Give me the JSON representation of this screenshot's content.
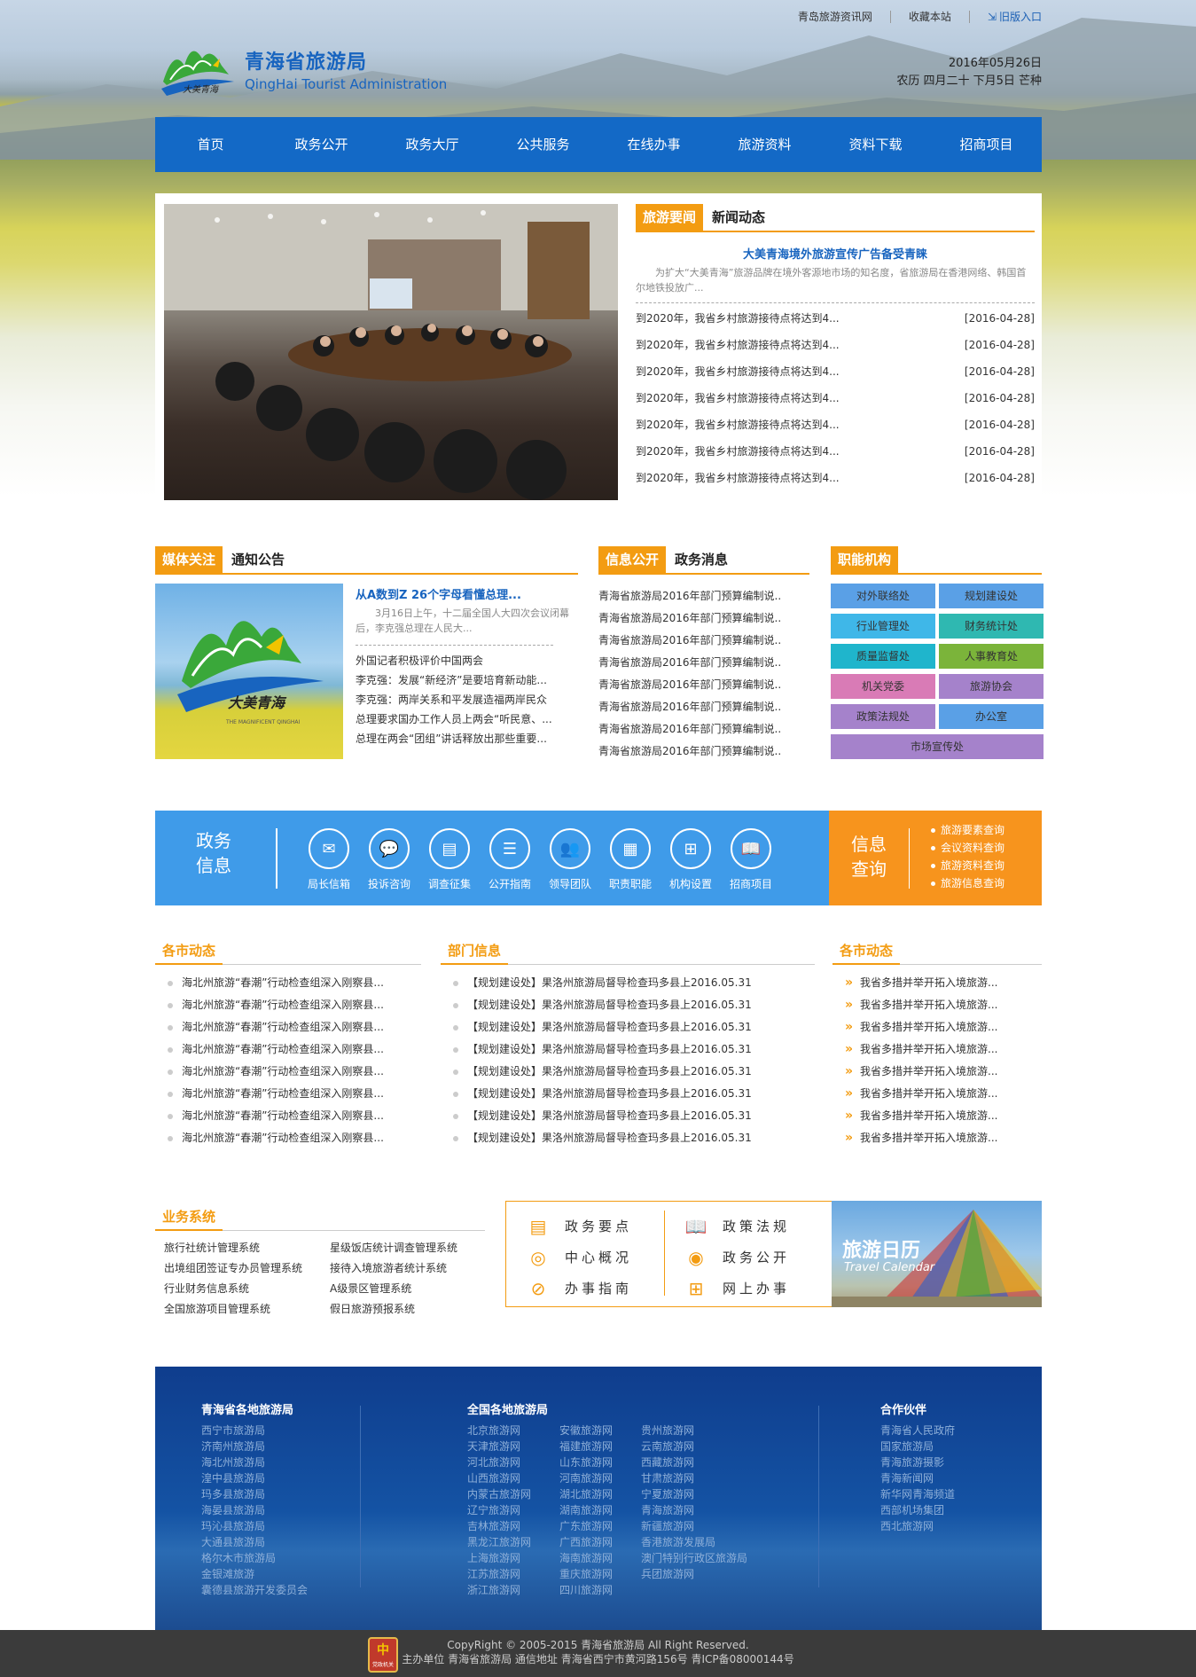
{
  "header": {
    "links": [
      "青岛旅游资讯网",
      "收藏本站",
      "旧版入口"
    ],
    "logo_cn": "青海省旅游局",
    "logo_en": "QingHai Tourist Administration",
    "logo_caption": "大美青海",
    "date_line1": "2016年05月26日",
    "date_line2": "农历 四月二十 下月5日 芒种"
  },
  "nav": [
    "首页",
    "政务公开",
    "政务大厅",
    "公共服务",
    "在线办事",
    "旅游资料",
    "资料下载",
    "招商项目"
  ],
  "news": {
    "tab_active": "旅游要闻",
    "tab_inactive": "新闻动态",
    "headline": "大美青海境外旅游宣传广告备受青睐",
    "summary": "为扩大“大美青海”旅游品牌在境外客源地市场的知名度，省旅游局在香港网络、韩国首尔地铁投放广...",
    "items": [
      {
        "title": "到2020年，我省乡村旅游接待点将达到4...",
        "date": "[2016-04-28]"
      },
      {
        "title": "到2020年，我省乡村旅游接待点将达到4...",
        "date": "[2016-04-28]"
      },
      {
        "title": "到2020年，我省乡村旅游接待点将达到4...",
        "date": "[2016-04-28]"
      },
      {
        "title": "到2020年，我省乡村旅游接待点将达到4...",
        "date": "[2016-04-28]"
      },
      {
        "title": "到2020年，我省乡村旅游接待点将达到4...",
        "date": "[2016-04-28]"
      },
      {
        "title": "到2020年，我省乡村旅游接待点将达到4...",
        "date": "[2016-04-28]"
      },
      {
        "title": "到2020年，我省乡村旅游接待点将达到4...",
        "date": "[2016-04-28]"
      }
    ]
  },
  "media": {
    "tab_active": "媒体关注",
    "tab_inactive": "通知公告",
    "image_caption": "大美青海",
    "image_sub": "THE MAGNIFICENT QINGHAI",
    "headline": "从A数到Z 26个字母看懂总理...",
    "summary": "3月16日上午，十二届全国人大四次会议闭幕后，李克强总理在人民大...",
    "items": [
      "外国记者积极评价中国两会",
      "李克强：发展“新经济”是要培育新动能...",
      "李克强：两岸关系和平发展造福两岸民众",
      "总理要求国办工作人员上两会“听民意、...",
      "总理在两会“团组”讲话释放出那些重要..."
    ]
  },
  "info": {
    "tab_active": "信息公开",
    "tab_inactive": "政务消息",
    "items": [
      "青海省旅游局2016年部门预算编制说..",
      "青海省旅游局2016年部门预算编制说..",
      "青海省旅游局2016年部门预算编制说..",
      "青海省旅游局2016年部门预算编制说..",
      "青海省旅游局2016年部门预算编制说..",
      "青海省旅游局2016年部门预算编制说..",
      "青海省旅游局2016年部门预算编制说..",
      "青海省旅游局2016年部门预算编制说.."
    ]
  },
  "org": {
    "title": "职能机构",
    "items": [
      {
        "label": "对外联络处",
        "color": "#5aa0e6"
      },
      {
        "label": "规划建设处",
        "color": "#5aa0e6"
      },
      {
        "label": "行业管理处",
        "color": "#3fb7e8"
      },
      {
        "label": "财务统计处",
        "color": "#2fb8b1"
      },
      {
        "label": "质量监督处",
        "color": "#1fb5cc"
      },
      {
        "label": "人事教育处",
        "color": "#7bb43a"
      },
      {
        "label": "机关党委",
        "color": "#d97bb6"
      },
      {
        "label": "旅游协会",
        "color": "#a582cb"
      },
      {
        "label": "政策法规处",
        "color": "#a582cb"
      },
      {
        "label": "办公室",
        "color": "#5aa0e6"
      }
    ],
    "wide": {
      "label": "市场宣传处",
      "color": "#a582cb"
    }
  },
  "band": {
    "left_title": "政务\n信息",
    "icons": [
      {
        "label": "局长信箱",
        "icon": "mail-icon"
      },
      {
        "label": "投诉咨询",
        "icon": "chat-icon"
      },
      {
        "label": "调查征集",
        "icon": "document-icon"
      },
      {
        "label": "公开指南",
        "icon": "notebook-icon"
      },
      {
        "label": "领导团队",
        "icon": "team-icon"
      },
      {
        "label": "职责职能",
        "icon": "grid-icon"
      },
      {
        "label": "机构设置",
        "icon": "window-icon"
      },
      {
        "label": "招商项目",
        "icon": "book-icon"
      }
    ],
    "right_title": "信息\n查询",
    "queries": [
      "旅游要素查询",
      "会议资料查询",
      "旅游资料查询",
      "旅游信息查询"
    ]
  },
  "cities": {
    "title": "各市动态",
    "items": [
      "海北州旅游“春潮”行动检查组深入刚察县...",
      "海北州旅游“春潮”行动检查组深入刚察县...",
      "海北州旅游“春潮”行动检查组深入刚察县...",
      "海北州旅游“春潮”行动检查组深入刚察县...",
      "海北州旅游“春潮”行动检查组深入刚察县...",
      "海北州旅游“春潮”行动检查组深入刚察县...",
      "海北州旅游“春潮”行动检查组深入刚察县...",
      "海北州旅游“春潮”行动检查组深入刚察县..."
    ]
  },
  "dept": {
    "title": "部门信息",
    "items": [
      "【规划建设处】果洛州旅游局督导检查玛多县上2016.05.31",
      "【规划建设处】果洛州旅游局督导检查玛多县上2016.05.31",
      "【规划建设处】果洛州旅游局督导检查玛多县上2016.05.31",
      "【规划建设处】果洛州旅游局督导检查玛多县上2016.05.31",
      "【规划建设处】果洛州旅游局督导检查玛多县上2016.05.31",
      "【规划建设处】果洛州旅游局督导检查玛多县上2016.05.31",
      "【规划建设处】果洛州旅游局督导检查玛多县上2016.05.31",
      "【规划建设处】果洛州旅游局督导检查玛多县上2016.05.31"
    ]
  },
  "cities2": {
    "title": "各市动态",
    "items": [
      "我省多措并举开拓入境旅游...",
      "我省多措并举开拓入境旅游...",
      "我省多措并举开拓入境旅游...",
      "我省多措并举开拓入境旅游...",
      "我省多措并举开拓入境旅游...",
      "我省多措并举开拓入境旅游...",
      "我省多措并举开拓入境旅游...",
      "我省多措并举开拓入境旅游..."
    ]
  },
  "biz": {
    "title": "业务系统",
    "col1": [
      "旅行社统计管理系统",
      "出境组团签证专办员管理系统",
      "行业财务信息系统",
      "全国旅游项目管理系统"
    ],
    "col2": [
      "星级饭店统计调查管理系统",
      "接待入境旅游者统计系统",
      "A级景区管理系统",
      "假日旅游预报系统"
    ]
  },
  "quick": {
    "left": [
      {
        "label": "政务要点",
        "icon": "notepad-icon"
      },
      {
        "label": "中心概况",
        "icon": "target-icon"
      },
      {
        "label": "办事指南",
        "icon": "compass-icon"
      }
    ],
    "right": [
      {
        "label": "政策法规",
        "icon": "open-book-icon"
      },
      {
        "label": "政务公开",
        "icon": "eye-icon"
      },
      {
        "label": "网上办事",
        "icon": "windows-icon"
      }
    ],
    "calendar_cn": "旅游日历",
    "calendar_en": "Travel Calendar"
  },
  "footer": {
    "col1_title": "青海省各地旅游局",
    "col1": [
      "西宁市旅游局",
      "济南州旅游局",
      "海北州旅游局",
      "湟中县旅游局",
      "玛多县旅游局",
      "海晏县旅游局",
      "玛沁县旅游局",
      "大通县旅游局",
      "格尔木市旅游局",
      "金银滩旅游",
      "囊德县旅游开发委员会"
    ],
    "col2_title": "全国各地旅游局",
    "col2a": [
      "北京旅游网",
      "天津旅游网",
      "河北旅游网",
      "山西旅游网",
      "内蒙古旅游网",
      "辽宁旅游网",
      "吉林旅游网",
      "黑龙江旅游网",
      "上海旅游网",
      "江苏旅游网",
      "浙江旅游网"
    ],
    "col2b": [
      "安徽旅游网",
      "福建旅游网",
      "山东旅游网",
      "河南旅游网",
      "湖北旅游网",
      "湖南旅游网",
      "广东旅游网",
      "广西旅游网",
      "海南旅游网",
      "重庆旅游网",
      "四川旅游网"
    ],
    "col2c": [
      "贵州旅游网",
      "云南旅游网",
      "西藏旅游网",
      "甘肃旅游网",
      "宁夏旅游网",
      "青海旅游网",
      "新疆旅游网",
      "香港旅游发展局",
      "澳门特别行政区旅游局",
      "兵团旅游网"
    ],
    "col3_title": "合作伙伴",
    "col3": [
      "青海省人民政府",
      "国家旅游局",
      "青海旅游摄影",
      "青海新闻网",
      "新华网青海频道",
      "西部机场集团",
      "西北旅游网"
    ],
    "copyright": "CopyRight © 2005-2015 青海省旅游局 All Right Reserved.",
    "address": "主办单位 青海省旅游局 通信地址 青海省西宁市黄河路156号 青ICP备08000144号",
    "badge_text": "党政机关"
  }
}
